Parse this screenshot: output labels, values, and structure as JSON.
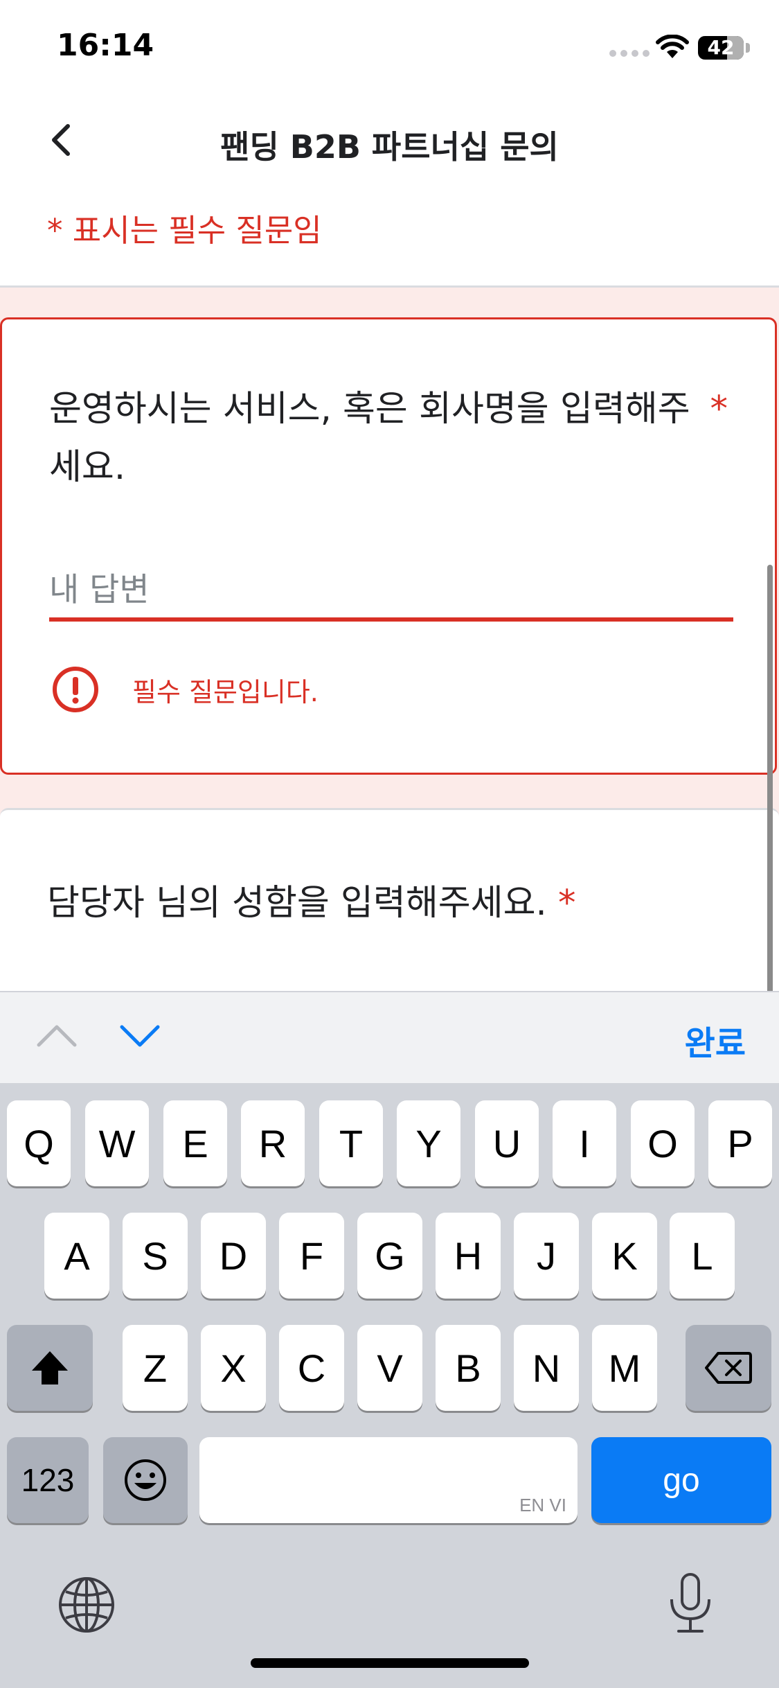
{
  "status_bar": {
    "time": "16:14",
    "battery": "42"
  },
  "nav": {
    "title": "팬딩 B2B 파트너십 문의"
  },
  "form": {
    "required_note": "* 표시는 필수 질문임",
    "question1": {
      "text": "운영하시는 서비스, 혹은 회사명을 입력해주세요.",
      "star": "*",
      "placeholder": "내 답변",
      "value": "",
      "error": "필수 질문입니다."
    },
    "question2": {
      "text": "담당자 님의 성함을 입력해주세요.",
      "star": "*"
    }
  },
  "keyboard_toolbar": {
    "done": "완료"
  },
  "keyboard": {
    "row1": [
      "Q",
      "W",
      "E",
      "R",
      "T",
      "Y",
      "U",
      "I",
      "O",
      "P"
    ],
    "row2": [
      "A",
      "S",
      "D",
      "F",
      "G",
      "H",
      "J",
      "K",
      "L"
    ],
    "row3": [
      "Z",
      "X",
      "C",
      "V",
      "B",
      "N",
      "M"
    ],
    "numbers_key": "123",
    "space_hint": "EN VI",
    "go_key": "go"
  },
  "colors": {
    "error": "#d93025",
    "accent": "#0a7bf5"
  },
  "icons": [
    "back-chevron-icon",
    "error-icon",
    "chevron-up-icon",
    "chevron-down-icon",
    "shift-icon",
    "backspace-icon",
    "emoji-icon",
    "globe-icon",
    "microphone-icon",
    "wifi-icon",
    "battery-icon"
  ]
}
